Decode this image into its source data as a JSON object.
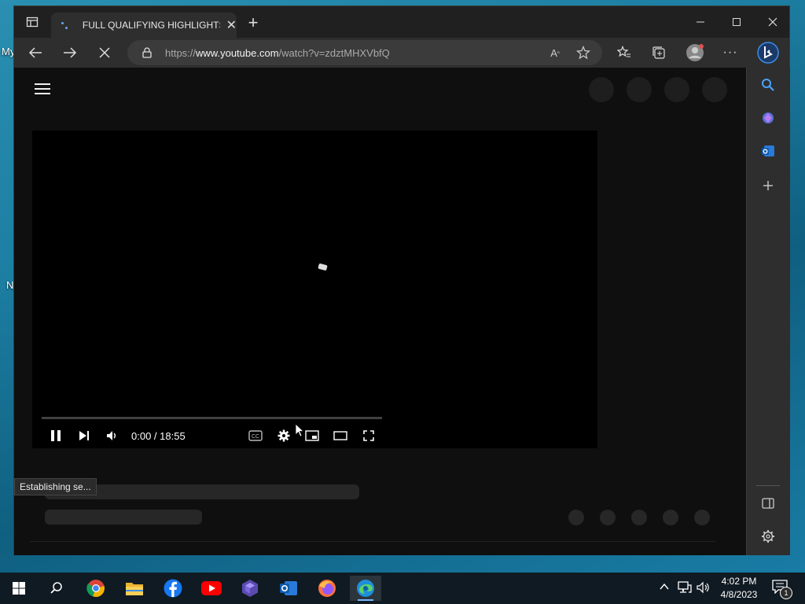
{
  "desktop": {
    "fragments": [
      "My",
      "N"
    ]
  },
  "tab": {
    "title": "FULL QUALIFYING HIGHLIGHTS -"
  },
  "address": {
    "scheme_prefix": "https://",
    "host": "www.youtube.com",
    "path": "/watch?v=zdztMHXVbfQ"
  },
  "player": {
    "time": "0:00 / 18:55"
  },
  "status_text": "Establishing se...",
  "clock": {
    "time": "4:02 PM",
    "date": "4/8/2023"
  },
  "notifications": {
    "count": "1"
  },
  "colors": {
    "taskbar_bg": "#101a22",
    "page_bg": "#0f0f0f",
    "edge_blue": "#3a8ee6",
    "youtube_red": "#ff0000"
  }
}
